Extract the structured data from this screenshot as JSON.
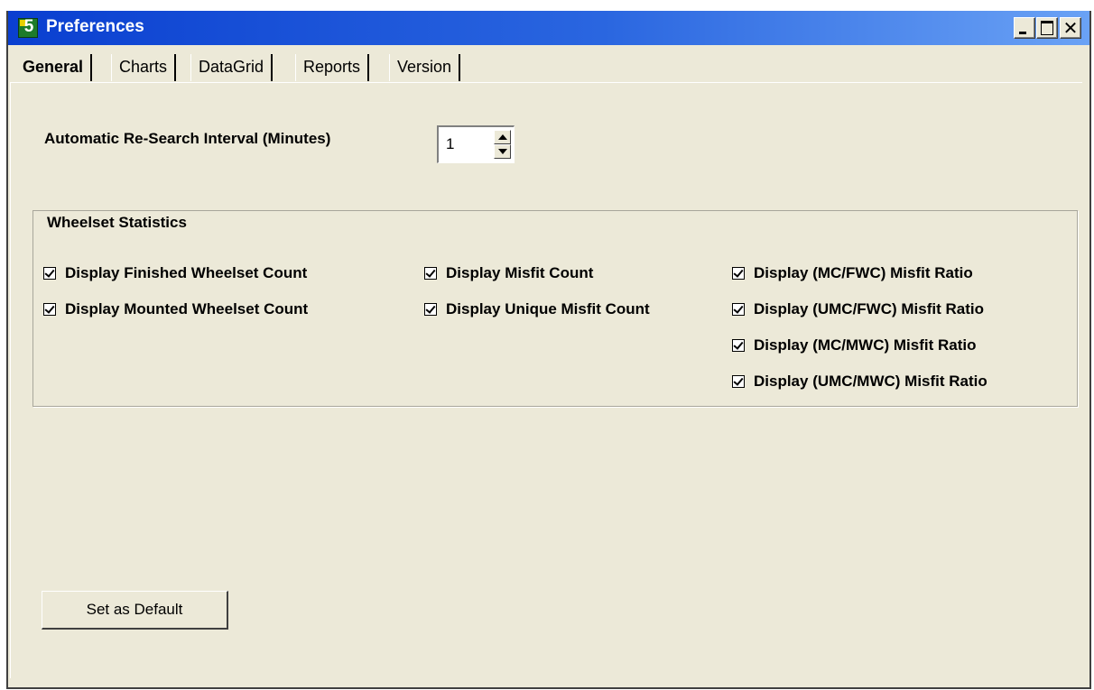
{
  "window": {
    "title": "Preferences",
    "app_icon_text": "5",
    "close_glyph": "✕",
    "colors": {
      "titlebar": "#0a3fd0",
      "face": "#ece9d8"
    }
  },
  "tabs": [
    {
      "label": "General",
      "active": true
    },
    {
      "label": "Charts",
      "active": false
    },
    {
      "label": "DataGrid",
      "active": false
    },
    {
      "label": "Reports",
      "active": false
    },
    {
      "label": "Version",
      "active": false
    }
  ],
  "general": {
    "interval_label": "Automatic Re-Search Interval (Minutes)",
    "interval_value": "1",
    "group_title": "Wheelset Statistics",
    "checkboxes": [
      {
        "label": "Display Finished Wheelset Count",
        "checked": true
      },
      {
        "label": "Display Mounted Wheelset Count",
        "checked": true
      },
      {
        "label": "Display Misfit Count",
        "checked": true
      },
      {
        "label": "Display Unique Misfit Count",
        "checked": true
      },
      {
        "label": "Display (MC/FWC) Misfit Ratio",
        "checked": true
      },
      {
        "label": "Display (UMC/FWC) Misfit Ratio",
        "checked": true
      },
      {
        "label": "Display (MC/MWC) Misfit Ratio",
        "checked": true
      },
      {
        "label": "Display (UMC/MWC) Misfit Ratio",
        "checked": true
      }
    ],
    "default_button": "Set as Default"
  }
}
